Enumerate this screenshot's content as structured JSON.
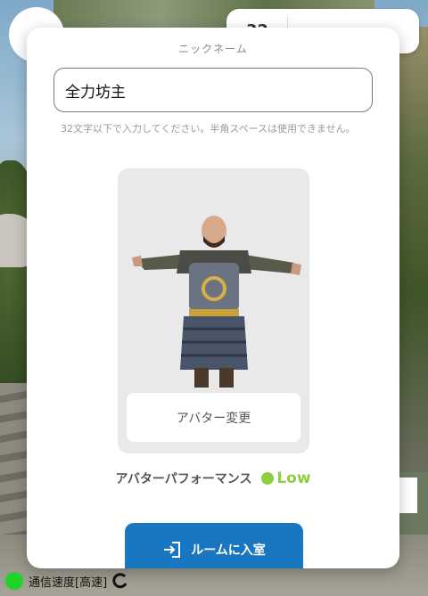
{
  "room_badge": {
    "count": "32"
  },
  "modal": {
    "nickname_title": "ニックネーム",
    "nickname_value": "全力坊主",
    "nickname_hint": "32文字以下で入力してください。半角スペースは使用できません。",
    "avatar_change_label": "アバター変更",
    "performance_label": "アバターパフォーマンス",
    "performance_level": "Low",
    "enter_button_label": "ルームに入室"
  },
  "status_bar": {
    "connection_text": "通信速度[高速]"
  },
  "colors": {
    "accent": "#1976c0",
    "performance_low": "#8ccf3f",
    "status_ok": "#21d22a"
  },
  "icons": [
    "enter-room-icon",
    "reload-icon",
    "avatar-figure"
  ]
}
